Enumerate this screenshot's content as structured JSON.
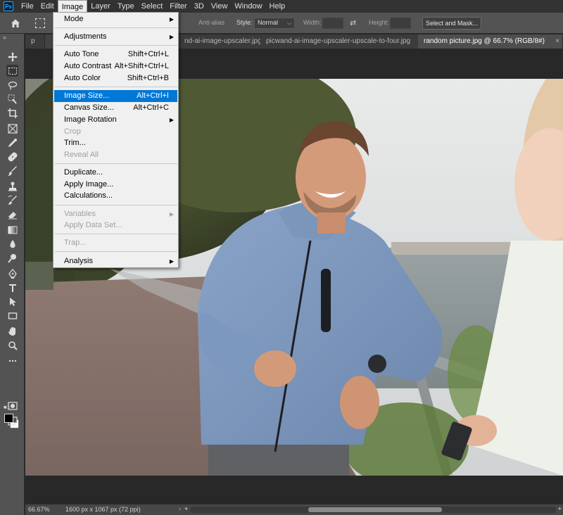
{
  "app": {
    "logo_text": "Ps"
  },
  "menubar": {
    "items": [
      "File",
      "Edit",
      "Image",
      "Layer",
      "Type",
      "Select",
      "Filter",
      "3D",
      "View",
      "Window",
      "Help"
    ],
    "active": "Image"
  },
  "options": {
    "anti_alias_label": "Anti-alias",
    "style_label": "Style:",
    "style_value": "Normal",
    "width_label": "Width:",
    "height_label": "Height:",
    "select_mask_label": "Select and Mask..."
  },
  "tabs": [
    {
      "label": "p"
    },
    {
      "label": "nd-ai-image-upscaler.jpg"
    },
    {
      "label": "picwand-ai-image-upscaler-upscale-to-four.jpg"
    },
    {
      "label": "random picture.jpg @ 66.7% (RGB/8#)"
    }
  ],
  "image_menu": {
    "items": [
      {
        "label": "Mode",
        "submenu": true
      },
      {
        "separator": true
      },
      {
        "label": "Adjustments",
        "submenu": true
      },
      {
        "separator": true
      },
      {
        "label": "Auto Tone",
        "shortcut": "Shift+Ctrl+L"
      },
      {
        "label": "Auto Contrast",
        "shortcut": "Alt+Shift+Ctrl+L"
      },
      {
        "label": "Auto Color",
        "shortcut": "Shift+Ctrl+B"
      },
      {
        "separator": true
      },
      {
        "label": "Image Size...",
        "shortcut": "Alt+Ctrl+I",
        "highlighted": true
      },
      {
        "label": "Canvas Size...",
        "shortcut": "Alt+Ctrl+C"
      },
      {
        "label": "Image Rotation",
        "submenu": true
      },
      {
        "label": "Crop",
        "disabled": true
      },
      {
        "label": "Trim..."
      },
      {
        "label": "Reveal All",
        "disabled": true
      },
      {
        "separator": true
      },
      {
        "label": "Duplicate..."
      },
      {
        "label": "Apply Image..."
      },
      {
        "label": "Calculations..."
      },
      {
        "separator": true
      },
      {
        "label": "Variables",
        "submenu": true,
        "disabled": true
      },
      {
        "label": "Apply Data Set...",
        "disabled": true
      },
      {
        "separator": true
      },
      {
        "label": "Trap...",
        "disabled": true
      },
      {
        "separator": true
      },
      {
        "label": "Analysis",
        "submenu": true
      }
    ]
  },
  "status": {
    "zoom": "66.67%",
    "doc_info": "1600 px x 1067 px (72 ppi)"
  },
  "tools": [
    "move-tool-icon",
    "marquee-tool-icon",
    "lasso-tool-icon",
    "quick-select-tool-icon",
    "crop-tool-icon",
    "frame-tool-icon",
    "eyedropper-tool-icon",
    "healing-brush-icon",
    "brush-tool-icon",
    "clone-stamp-icon",
    "history-brush-icon",
    "eraser-tool-icon",
    "gradient-tool-icon",
    "blur-tool-icon",
    "dodge-tool-icon",
    "pen-tool-icon",
    "type-tool-icon",
    "path-select-icon",
    "rectangle-tool-icon",
    "hand-tool-icon",
    "zoom-tool-icon",
    "more-tools-icon"
  ],
  "colors": {
    "menu_highlight": "#0078d7",
    "panel": "#535353",
    "workspace": "#282828",
    "foreground": "#000000",
    "background": "#ffffff"
  }
}
